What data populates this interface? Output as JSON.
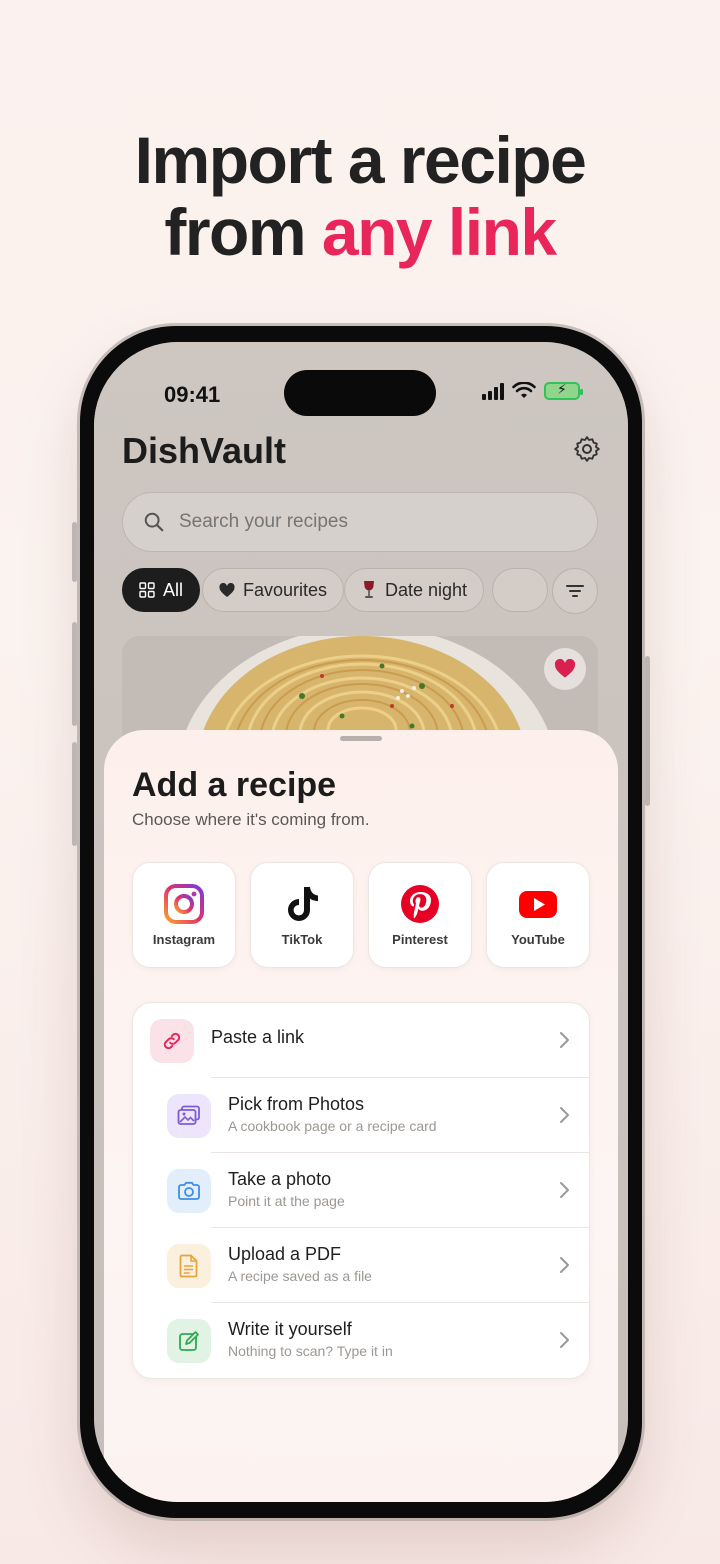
{
  "headline": {
    "line1": "Import a recipe",
    "line2_prefix": "from ",
    "line2_accent": "any link"
  },
  "status_bar": {
    "time": "09:41"
  },
  "app": {
    "title": "DishVault",
    "search": {
      "placeholder": "Search your recipes",
      "value": ""
    },
    "chips": [
      {
        "label": "All",
        "icon": "grid-icon",
        "active": true
      },
      {
        "label": "Favourites",
        "icon": "heart-icon",
        "active": false
      },
      {
        "label": "Date night",
        "icon": "wine-glass-icon",
        "active": false
      },
      {
        "label": "",
        "icon": "moon-icon",
        "active": false
      }
    ]
  },
  "sheet": {
    "title": "Add a recipe",
    "subtitle": "Choose where it's coming from.",
    "sources": [
      {
        "label": "Instagram",
        "icon": "instagram-icon"
      },
      {
        "label": "TikTok",
        "icon": "tiktok-icon"
      },
      {
        "label": "Pinterest",
        "icon": "pinterest-icon"
      },
      {
        "label": "YouTube",
        "icon": "youtube-icon"
      }
    ],
    "options": [
      {
        "title": "Paste a link",
        "subtitle": "",
        "icon": "link-icon",
        "color": "#e8265a"
      },
      {
        "title": "Pick from Photos",
        "subtitle": "A cookbook page or a recipe card",
        "icon": "photos-icon",
        "color": "#7b5cd6"
      },
      {
        "title": "Take a photo",
        "subtitle": "Point it at the page",
        "icon": "camera-icon",
        "color": "#3d8ee8"
      },
      {
        "title": "Upload a PDF",
        "subtitle": "A recipe saved as a file",
        "icon": "document-icon",
        "color": "#e8a23d"
      },
      {
        "title": "Write it yourself",
        "subtitle": "Nothing to scan? Type it in",
        "icon": "edit-icon",
        "color": "#2fa84f"
      }
    ]
  },
  "colors": {
    "accent": "#e8265a",
    "primary_text": "#1e1e1e"
  }
}
